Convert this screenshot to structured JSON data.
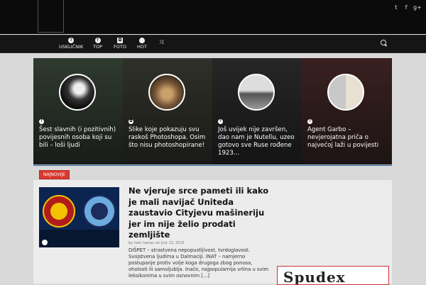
{
  "nav": {
    "items": [
      {
        "label": "USKLIČNIK"
      },
      {
        "label": "TOP"
      },
      {
        "label": "FOTO"
      },
      {
        "label": "HOT"
      }
    ]
  },
  "slider": [
    {
      "caption": "Šest slavnih (i pozitivnih) povijesnih osoba koji su bili – loši ljudi"
    },
    {
      "caption": "Slike koje pokazuju svu raskoš Photoshopa. Osim što nisu photoshopirane!"
    },
    {
      "caption": "Još uvijek nije završen, dao nam je Nutellu, uzeo gotovo sve Ruse rođene 1923..."
    },
    {
      "caption": "Agent Garbo – nevjerojatna priča o najvećoj laži u povijesti"
    }
  ],
  "section_badge": "NAJNOVIJE",
  "featured": {
    "title": "Ne vjeruje srce pameti ili kako je mali navijač Uniteda zaustavio Cityjevu mašineriju jer im nije želio prodati zemljište",
    "meta": "by Ivan Ivanac  on July 13, 2015",
    "excerpt": "DIŠPET – strastvena nepopustljivost, tvrdoglavost. Svojstvena ljudima u Dalmaciji. INAT – namjerno postupanje protiv volje koga drugoga zbog ponosa, oholosti ili samoljublja. Inače, najpopularnija vrlina u svim leksikonima u svim osnovnim [...]"
  },
  "promo": {
    "text": "Spudex"
  }
}
